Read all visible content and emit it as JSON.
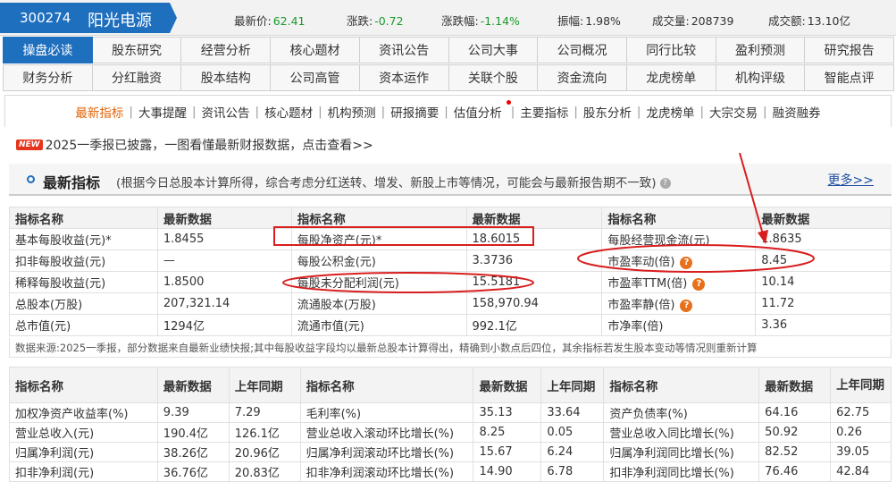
{
  "stock": {
    "code": "300274",
    "name": "阳光电源"
  },
  "quote": [
    {
      "label": "最新价:",
      "value": "62.41",
      "color": "#1a9a2a"
    },
    {
      "label": "涨跌:",
      "value": "-0.72",
      "color": "#1a9a2a"
    },
    {
      "label": "涨跌幅:",
      "value": "-1.14%",
      "color": "#1a9a2a"
    },
    {
      "label": "振幅:",
      "value": "1.98%",
      "color": "#333333"
    },
    {
      "label": "成交量:",
      "value": "208739",
      "color": "#333333"
    },
    {
      "label": "成交额:",
      "value": "13.10亿",
      "color": "#333333"
    }
  ],
  "nav_row1": [
    "操盘必读",
    "股东研究",
    "经营分析",
    "核心题材",
    "资讯公告",
    "公司大事",
    "公司概况",
    "同行比较",
    "盈利预测",
    "研究报告"
  ],
  "nav_row2": [
    "财务分析",
    "分红融资",
    "股本结构",
    "公司高管",
    "资本运作",
    "关联个股",
    "资金流向",
    "龙虎榜单",
    "机构评级",
    "智能点评"
  ],
  "subnav": [
    "最新指标",
    "大事提醒",
    "资讯公告",
    "核心题材",
    "机构预测",
    "研报摘要",
    "估值分析",
    "主要指标",
    "股东分析",
    "龙虎榜单",
    "大宗交易",
    "融资融券"
  ],
  "notice": {
    "badge": "NEW",
    "text": "2025一季报已披露，一图看懂最新财报数据，点击查看>>"
  },
  "section": {
    "title": "最新指标",
    "desc": "(根据今日总股本计算所得，综合考虑分红送转、增发、新股上市等情况，可能会与最新报告期不一致)",
    "more": "更多>>",
    "qmark": "?"
  },
  "table1": {
    "headers": [
      "指标名称",
      "最新数据",
      "指标名称",
      "最新数据",
      "指标名称",
      "最新数据"
    ],
    "rows": [
      [
        "基本每股收益(元)*",
        "1.8455",
        "每股净资产(元)*",
        "18.6015",
        "每股经营现金流(元)",
        "1.8635"
      ],
      [
        "扣非每股收益(元)",
        "—",
        "每股公积金(元)",
        "3.3736",
        "市盈率动(倍)",
        "8.45"
      ],
      [
        "稀释每股收益(元)",
        "1.8500",
        "每股未分配利润(元)",
        "15.5181",
        "市盈率TTM(倍)",
        "10.14"
      ],
      [
        "总股本(万股)",
        "207,321.14",
        "流通股本(万股)",
        "158,970.94",
        "市盈率静(倍)",
        "11.72"
      ],
      [
        "总市值(元)",
        "1294亿",
        "流通市值(元)",
        "992.1亿",
        "市净率(倍)",
        "3.36"
      ]
    ],
    "source": "数据来源:2025一季报，部分数据来自最新业绩快报;其中每股收益字段均以最新总股本计算得出，精确到小数点后四位，其余指标若发生股本变动等情况则重新计算"
  },
  "table2": {
    "headers": [
      "指标名称",
      "最新数据",
      "上年同期",
      "指标名称",
      "最新数据",
      "上年同期",
      "指标名称",
      "最新数据",
      "上年同期"
    ],
    "rows": [
      [
        "加权净资产收益率(%)",
        "9.39",
        "7.29",
        "毛利率(%)",
        "35.13",
        "33.64",
        "资产负债率(%)",
        "64.16",
        "62.75"
      ],
      [
        "营业总收入(元)",
        "190.4亿",
        "126.1亿",
        "营业总收入滚动环比增长(%)",
        "8.25",
        "0.05",
        "营业总收入同比增长(%)",
        "50.92",
        "0.26"
      ],
      [
        "归属净利润(元)",
        "38.26亿",
        "20.96亿",
        "归属净利润滚动环比增长(%)",
        "15.67",
        "6.24",
        "归属净利润同比增长(%)",
        "82.52",
        "39.05"
      ],
      [
        "扣非净利润(元)",
        "36.76亿",
        "20.83亿",
        "扣非净利润滚动环比增长(%)",
        "14.90",
        "6.78",
        "扣非净利润同比增长(%)",
        "76.46",
        "42.84"
      ]
    ]
  },
  "colors": {
    "accent": "#1f6fbf",
    "highlight": "#e0640a",
    "annotation": "#d81e1e",
    "down": "#1a9a2a"
  }
}
